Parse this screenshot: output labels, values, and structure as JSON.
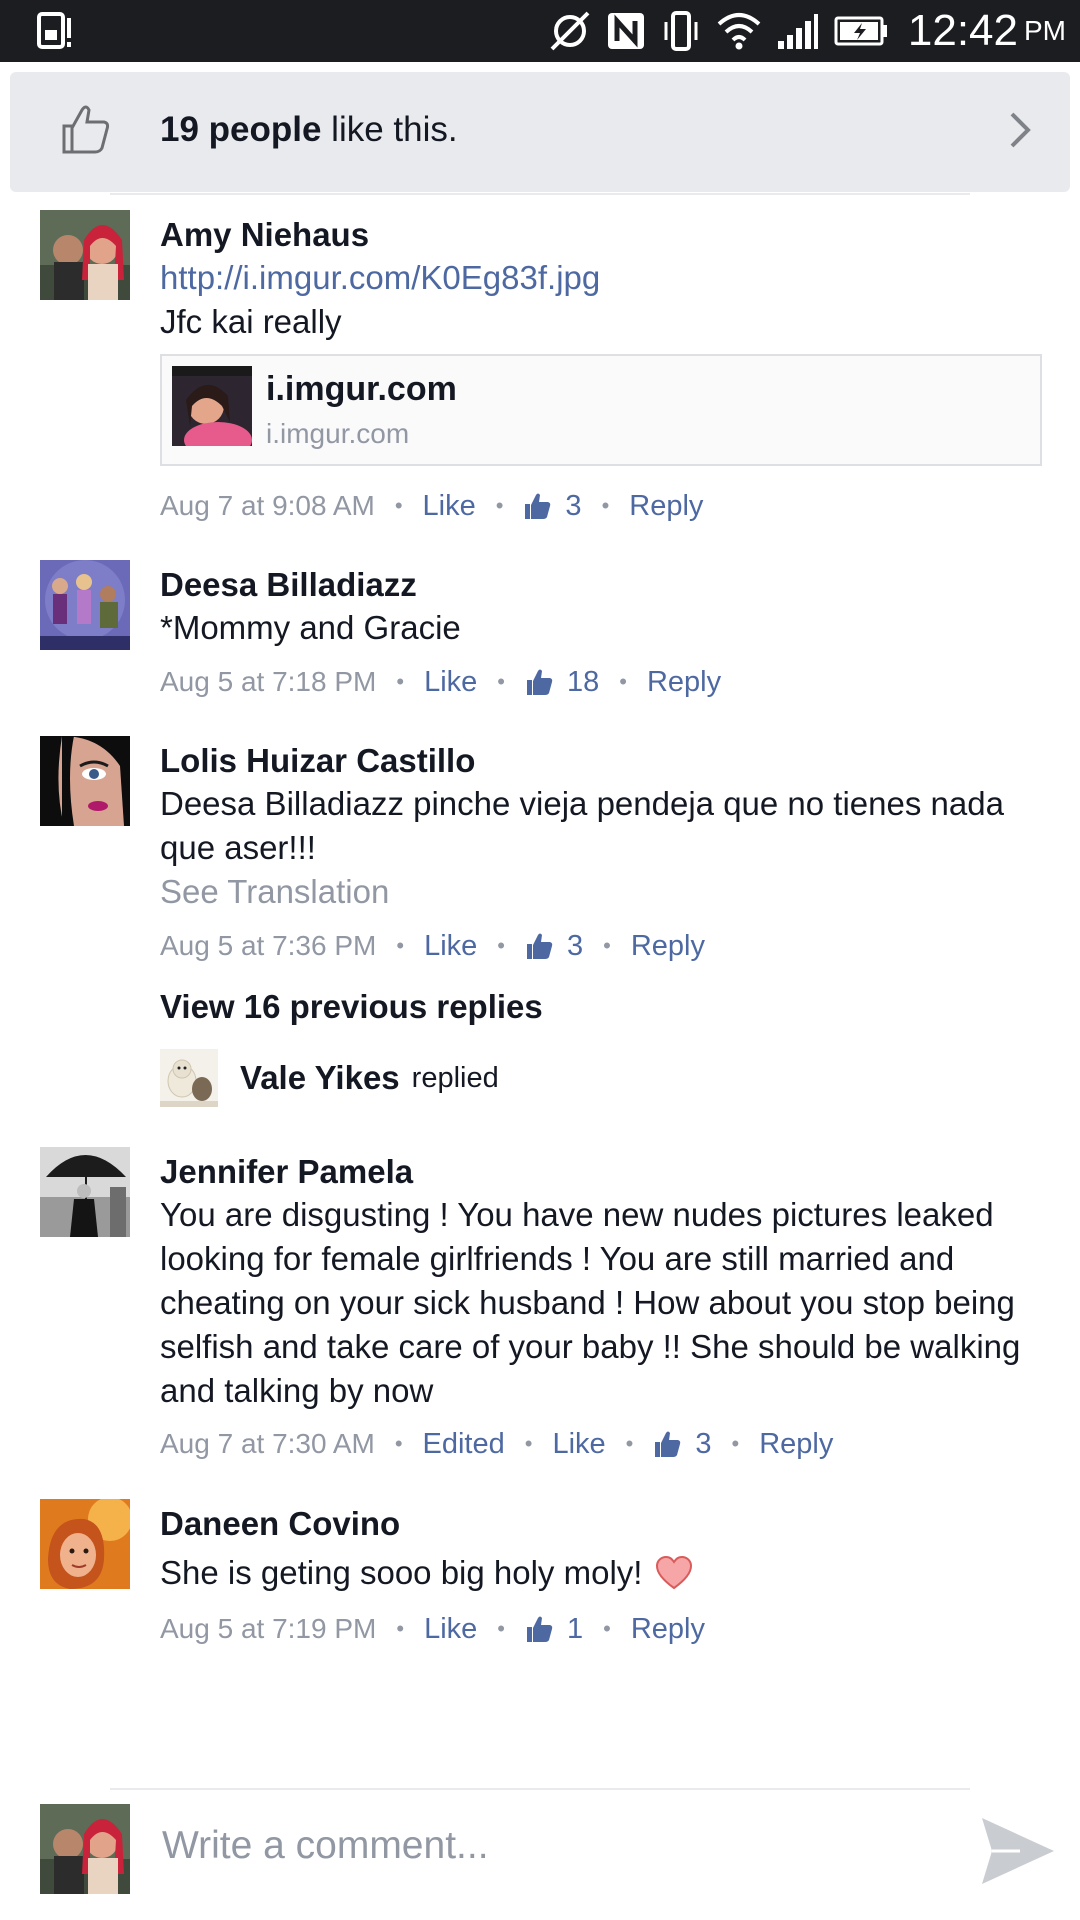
{
  "status_bar": {
    "time": "12:42",
    "ampm": "PM"
  },
  "likes": {
    "count_text": "19 people",
    "suffix": " like this."
  },
  "comments": [
    {
      "author": "Amy Niehaus",
      "link": "http://i.imgur.com/K0Eg83f.jpg",
      "text": "Jfc kai really",
      "preview": {
        "title": "i.imgur.com",
        "subtitle": "i.imgur.com"
      },
      "time": "Aug 7 at 9:08 AM",
      "like_label": "Like",
      "likes": "3",
      "reply_label": "Reply"
    },
    {
      "author": "Deesa Billadiazz",
      "text": "*Mommy and Gracie",
      "time": "Aug 5 at 7:18 PM",
      "like_label": "Like",
      "likes": "18",
      "reply_label": "Reply"
    },
    {
      "author": "Lolis Huizar Castillo",
      "text": "Deesa Billadiazz pinche vieja pendeja que no tienes nada que aser!!!",
      "see_translation": "See Translation",
      "time": "Aug 5 at 7:36 PM",
      "like_label": "Like",
      "likes": "3",
      "reply_label": "Reply",
      "view_previous": "View 16 previous replies",
      "last_reply": {
        "name": "Vale Yikes",
        "word": "replied"
      }
    },
    {
      "author": "Jennifer Pamela",
      "text": "You are disgusting ! You have new nudes pictures leaked looking for female girlfriends ! You are still married and cheating on your sick husband ! How about you stop being selfish and take care of your baby !! She should be walking and talking by now",
      "time": "Aug 7 at 7:30 AM",
      "edited_label": "Edited",
      "like_label": "Like",
      "likes": "3",
      "reply_label": "Reply"
    },
    {
      "author": "Daneen Covino",
      "text": "She is geting sooo big holy moly!",
      "time": "Aug 5 at 7:19 PM",
      "like_label": "Like",
      "likes": "1",
      "reply_label": "Reply"
    }
  ],
  "composer": {
    "placeholder": "Write a comment..."
  },
  "colors": {
    "link": "#4e69a2",
    "meta_gray": "#9197a3",
    "likes_bar_bg": "#e9eaed",
    "status_bar_bg": "#1c1d21"
  },
  "icons": [
    "sim-icon",
    "alert-icon",
    "sync-off-icon",
    "nfc-icon",
    "vibrate-icon",
    "wifi-icon",
    "signal-icon",
    "battery-charging-icon",
    "thumbs-up-icon",
    "chevron-right-icon",
    "heart-icon",
    "send-icon"
  ]
}
